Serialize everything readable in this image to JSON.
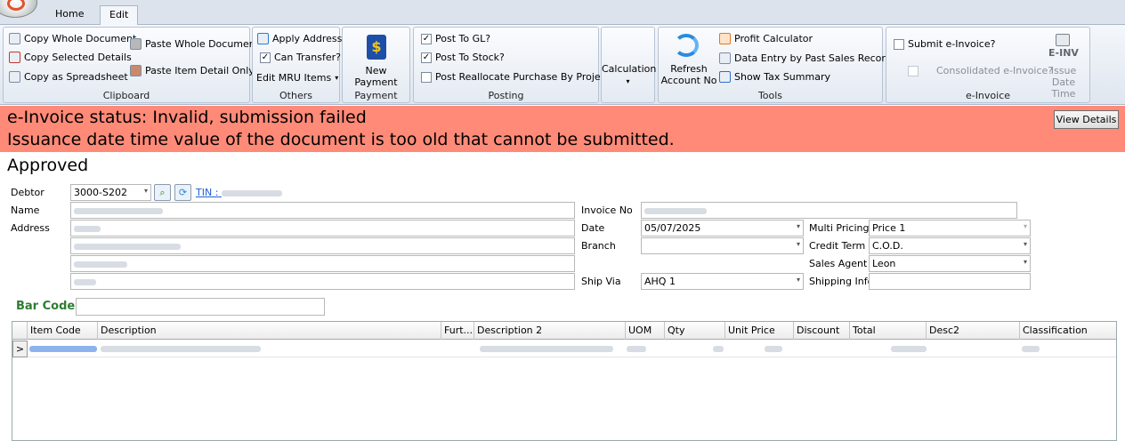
{
  "ribbon": {
    "tabs": [
      "Home",
      "Edit"
    ],
    "clipboard": {
      "label": "Clipboard",
      "copy_whole": "Copy Whole Document",
      "copy_selected": "Copy Selected Details",
      "copy_spreadsheet": "Copy as Spreadsheet",
      "paste_whole": "Paste Whole Document",
      "paste_item": "Paste Item Detail Only"
    },
    "others": {
      "label": "Others",
      "apply_address": "Apply Address",
      "can_transfer": "Can Transfer?",
      "edit_mru": "Edit MRU Items"
    },
    "payment": {
      "label": "Payment",
      "new_payment": "New Payment"
    },
    "posting": {
      "label": "Posting",
      "post_gl": "Post To GL?",
      "post_stock": "Post To Stock?",
      "post_reallocate": "Post Reallocate Purchase By Project?"
    },
    "calculation": {
      "label": "Calculation"
    },
    "tools": {
      "label": "Tools",
      "refresh_line1": "Refresh",
      "refresh_line2": "Account No",
      "profit_calc": "Profit Calculator",
      "data_entry": "Data Entry by Past Sales Records",
      "tax_summary": "Show Tax Summary"
    },
    "einvoice": {
      "label": "e-Invoice",
      "submit": "Submit e-Invoice?",
      "consolidated": "Consolidated e-Invoice?",
      "einv": "E-INV",
      "issue_line1": "Issue",
      "issue_line2": "Date Time"
    }
  },
  "status": {
    "line1": "e-Invoice status: Invalid, submission failed",
    "line2": "Issuance date time value of the document is too old that cannot be submitted.",
    "view_details": "View Details"
  },
  "doc_status": "Approved",
  "form": {
    "debtor_label": "Debtor",
    "debtor_value": "3000-S202",
    "tin_label": "TIN :",
    "name_label": "Name",
    "address_label": "Address",
    "invoice_no_label": "Invoice No",
    "date_label": "Date",
    "date_value": "05/07/2025",
    "branch_label": "Branch",
    "ship_via_label": "Ship Via",
    "ship_via_value": "AHQ 1",
    "multi_pricing_label": "Multi Pricing",
    "multi_pricing_value": "Price 1",
    "credit_term_label": "Credit Term",
    "credit_term_value": "C.O.D.",
    "sales_agent_label": "Sales Agent",
    "sales_agent_value": "Leon",
    "shipping_info_label": "Shipping Info",
    "barcode_label": "Bar Code"
  },
  "grid": {
    "columns": [
      "Item Code",
      "Description",
      "Furt...",
      "Description 2",
      "UOM",
      "Qty",
      "Unit Price",
      "Discount",
      "Total",
      "Desc2",
      "Classification"
    ],
    "row_indicator": ">"
  },
  "colors": {
    "status_bg": "#ff8a78",
    "barcode_label": "#2e7d32",
    "tin_link": "#1f5fd6"
  }
}
